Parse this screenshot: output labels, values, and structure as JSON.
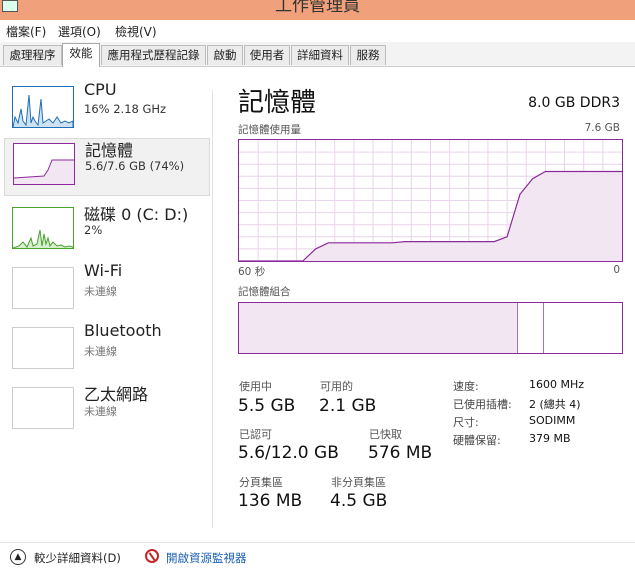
{
  "window": {
    "title": "工作管理員"
  },
  "menu": [
    "檔案(F)",
    "選項(O)",
    "檢視(V)"
  ],
  "tabs": [
    "處理程序",
    "效能",
    "應用程式歷程記錄",
    "啟動",
    "使用者",
    "詳細資料",
    "服務"
  ],
  "sidebar": [
    {
      "title": "CPU",
      "sub": "16%  2.18 GHz",
      "color": "#1e6fb5"
    },
    {
      "title": "記憶體",
      "sub": "5.6/7.6 GB (74%)",
      "color": "#8b2a9a"
    },
    {
      "title": "磁碟 0 (C: D:)",
      "sub": "2%",
      "color": "#4aa12e"
    },
    {
      "title": "Wi-Fi",
      "sub": "未連線"
    },
    {
      "title": "Bluetooth",
      "sub": "未連線"
    },
    {
      "title": "乙太網路",
      "sub": "未連線"
    }
  ],
  "detail": {
    "heading": "記憶體",
    "spec": "8.0 GB DDR3",
    "usage_label": "記憶體使用量",
    "usage_max": "7.6 GB",
    "time_left": "60 秒",
    "time_right": "0",
    "composition_label": "記憶體組合",
    "usage_fraction_series": [
      0,
      0,
      0,
      0,
      0,
      0,
      0.1,
      0.15,
      0.15,
      0.15,
      0.15,
      0.15,
      0.15,
      0.16,
      0.16,
      0.16,
      0.16,
      0.16,
      0.16,
      0.16,
      0.16,
      0.2,
      0.55,
      0.68,
      0.74,
      0.74,
      0.74,
      0.74,
      0.74,
      0.74,
      0.74
    ],
    "stats": [
      {
        "label": "使用中",
        "value": "5.5 GB"
      },
      {
        "label": "可用的",
        "value": "2.1 GB"
      },
      {
        "label": "已認可",
        "value": "5.6/12.0 GB"
      },
      {
        "label": "已快取",
        "value": "576 MB"
      },
      {
        "label": "分頁集區",
        "value": "136 MB"
      },
      {
        "label": "非分頁集區",
        "value": "4.5 GB"
      }
    ],
    "info": [
      {
        "label": "速度:",
        "value": "1600 MHz"
      },
      {
        "label": "已使用插槽:",
        "value": "2 (總共 4)"
      },
      {
        "label": "尺寸:",
        "value": "SODIMM"
      },
      {
        "label": "硬體保留:",
        "value": "379 MB"
      }
    ]
  },
  "footer": {
    "less": "較少詳細資料(D)",
    "monitor": "開啟資源監視器"
  }
}
